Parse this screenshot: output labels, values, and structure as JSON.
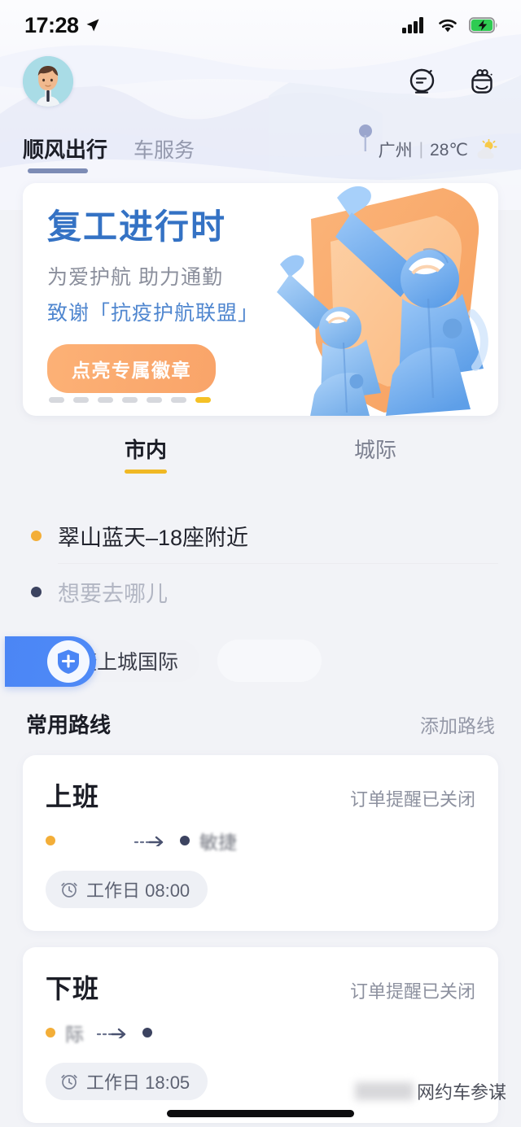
{
  "status_bar": {
    "time": "17:28",
    "location_icon": "location-arrow-icon",
    "signal_icon": "cellular-signal-icon",
    "wifi_icon": "wifi-icon",
    "battery_icon": "battery-charging-icon"
  },
  "header": {
    "avatar": "user-avatar",
    "icons": [
      {
        "name": "message-bubble-icon"
      },
      {
        "name": "gift-bag-icon"
      }
    ],
    "nav_tabs": [
      {
        "label": "顺风出行",
        "active": true
      },
      {
        "label": "车服务",
        "active": false
      }
    ],
    "weather": {
      "city": "广州",
      "divider": "|",
      "temperature": "28℃",
      "icon": "sun-behind-cloud-icon"
    }
  },
  "banner": {
    "title": "复工进行时",
    "subtitle1": "为爱护航 助力通勤",
    "subtitle2": "致谢「抗疫护航联盟」",
    "button_label": "点亮专属徽章",
    "illustration": "medical-workers-shield-illustration",
    "dots": {
      "total": 7,
      "active_index": 6
    },
    "colors": {
      "title": "#3472c4",
      "subtitle2": "#4f86cf",
      "button": "#f9a469",
      "active_dot": "#f5c126"
    }
  },
  "segment_tabs": [
    {
      "label": "市内",
      "active": true
    },
    {
      "label": "城际",
      "active": false
    }
  ],
  "address": {
    "origin": {
      "text": "翠山蓝天–18座附近",
      "dot_color": "#f3ae38"
    },
    "destination": {
      "placeholder": "想要去哪儿",
      "dot_color": "#3c4360"
    }
  },
  "chips": [
    {
      "label": "捷上城国际"
    },
    {
      "label": ""
    }
  ],
  "float_badge": {
    "icon": "shield-plus-icon",
    "color": "#4b86f5"
  },
  "routes": {
    "title": "常用路线",
    "action_label": "添加路线",
    "items": [
      {
        "name": "上班",
        "status": "订单提醒已关闭",
        "origin": "",
        "destination": "敏捷",
        "arrow_icon": "dotted-arrow-icon",
        "clock_icon": "alarm-clock-icon",
        "time_label": "工作日 08:00"
      },
      {
        "name": "下班",
        "status": "订单提醒已关闭",
        "origin": "际",
        "destination": "",
        "arrow_icon": "dotted-arrow-icon",
        "clock_icon": "alarm-clock-icon",
        "time_label": "工作日 18:05"
      }
    ]
  },
  "watermark": {
    "text": "网约车参谋"
  }
}
